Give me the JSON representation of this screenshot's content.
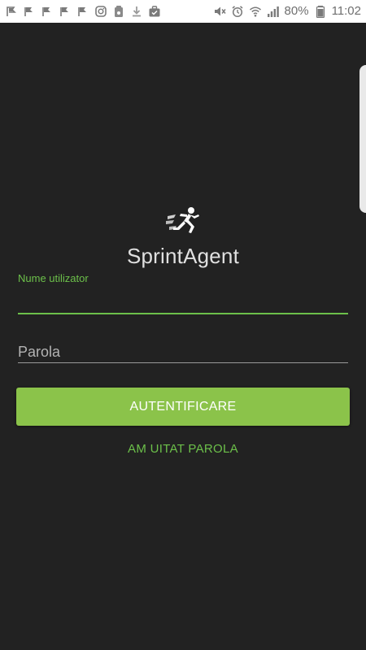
{
  "status_bar": {
    "left_icons": [
      "flag-icon",
      "flag-icon",
      "flag-icon",
      "flag-icon",
      "flag-icon",
      "instagram-icon",
      "app-icon",
      "download-icon",
      "briefcase-icon"
    ],
    "right_icons": [
      "mute-icon",
      "alarm-icon",
      "wifi-icon",
      "signal-icon"
    ],
    "battery": "80%",
    "time": "11:02"
  },
  "app": {
    "name": "SprintAgent",
    "logo": "runner-logo-icon"
  },
  "form": {
    "username_label": "Nume utilizator",
    "username_value": "",
    "password_placeholder": "Parola",
    "login_label": "AUTENTIFICARE",
    "forgot_label": "AM UITAT PAROLA"
  },
  "colors": {
    "background": "#222222",
    "accent": "#8bc34a",
    "accent_text": "#6cc04a",
    "status_bar": "#ffffff"
  }
}
